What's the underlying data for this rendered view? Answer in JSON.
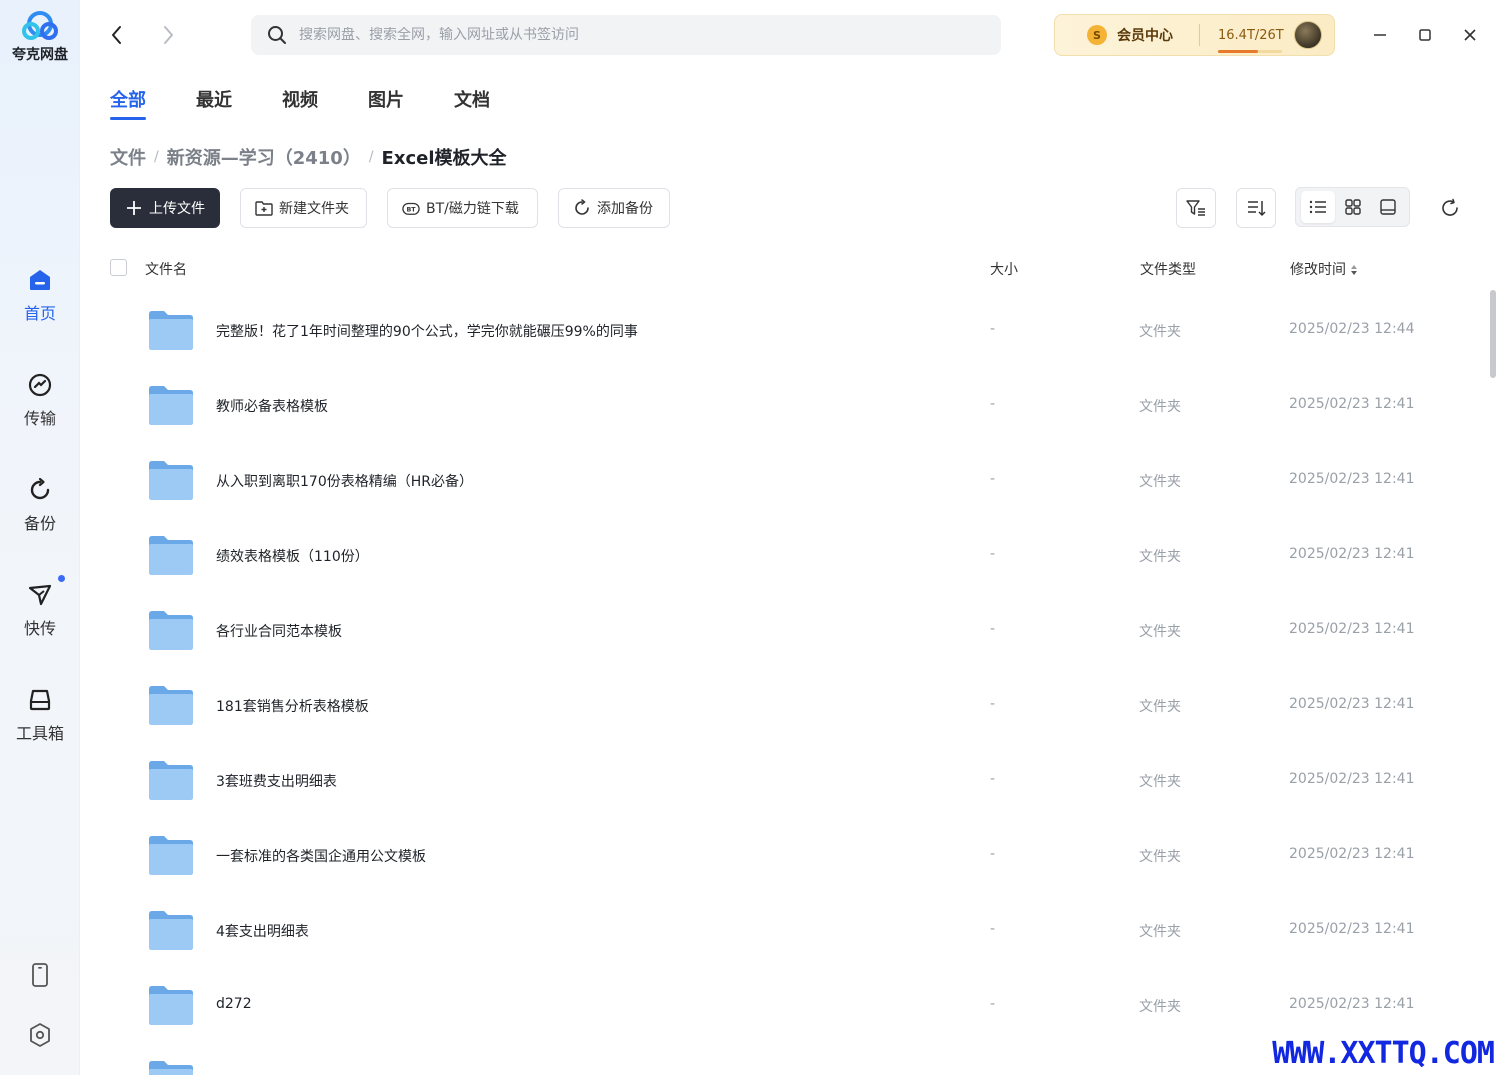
{
  "app": {
    "name": "夸克网盘"
  },
  "sidebar": {
    "items": [
      {
        "label": "首页",
        "icon": "home-icon",
        "active": true
      },
      {
        "label": "传输",
        "icon": "transfer-icon",
        "active": false
      },
      {
        "label": "备份",
        "icon": "backup-icon",
        "active": false
      },
      {
        "label": "快传",
        "icon": "quick-send-icon",
        "active": false
      },
      {
        "label": "工具箱",
        "icon": "toolbox-icon",
        "active": false
      }
    ]
  },
  "search": {
    "placeholder": "搜索网盘、搜索全网，输入网址或从书签访问"
  },
  "vip": {
    "label": "会员中心",
    "coin_symbol": "S",
    "storage": "16.4T/26T",
    "storage_used_fraction": 0.63
  },
  "tabs": [
    "全部",
    "最近",
    "视频",
    "图片",
    "文档"
  ],
  "breadcrumb": [
    "文件",
    "新资源—学习（2410）",
    "Excel模板大全"
  ],
  "toolbar": {
    "upload": "上传文件",
    "new_folder": "新建文件夹",
    "bt_download": "BT/磁力链下载",
    "add_backup": "添加备份"
  },
  "table": {
    "columns": {
      "name": "文件名",
      "size": "大小",
      "type": "文件类型",
      "mtime": "修改时间"
    },
    "rows": [
      {
        "name": "完整版！花了1年时间整理的90个公式，学完你就能碾压99%的同事",
        "size": "-",
        "type": "文件夹",
        "mtime": "2025/02/23 12:44"
      },
      {
        "name": "教师必备表格模板",
        "size": "-",
        "type": "文件夹",
        "mtime": "2025/02/23 12:41"
      },
      {
        "name": "从入职到离职170份表格精编（HR必备）",
        "size": "-",
        "type": "文件夹",
        "mtime": "2025/02/23 12:41"
      },
      {
        "name": "绩效表格模板（110份）",
        "size": "-",
        "type": "文件夹",
        "mtime": "2025/02/23 12:41"
      },
      {
        "name": "各行业合同范本模板",
        "size": "-",
        "type": "文件夹",
        "mtime": "2025/02/23 12:41"
      },
      {
        "name": "181套销售分析表格模板",
        "size": "-",
        "type": "文件夹",
        "mtime": "2025/02/23 12:41"
      },
      {
        "name": "3套班费支出明细表",
        "size": "-",
        "type": "文件夹",
        "mtime": "2025/02/23 12:41"
      },
      {
        "name": "一套标准的各类国企通用公文模板",
        "size": "-",
        "type": "文件夹",
        "mtime": "2025/02/23 12:41"
      },
      {
        "name": "4套支出明细表",
        "size": "-",
        "type": "文件夹",
        "mtime": "2025/02/23 12:41"
      },
      {
        "name": "d272",
        "size": "-",
        "type": "文件夹",
        "mtime": "2025/02/23 12:41"
      }
    ]
  },
  "watermark": "WWW.XXTTQ.COM",
  "colors": {
    "accent": "#2563eb",
    "primary_button": "#2a2e3a",
    "folder": "#7fb6ec"
  }
}
